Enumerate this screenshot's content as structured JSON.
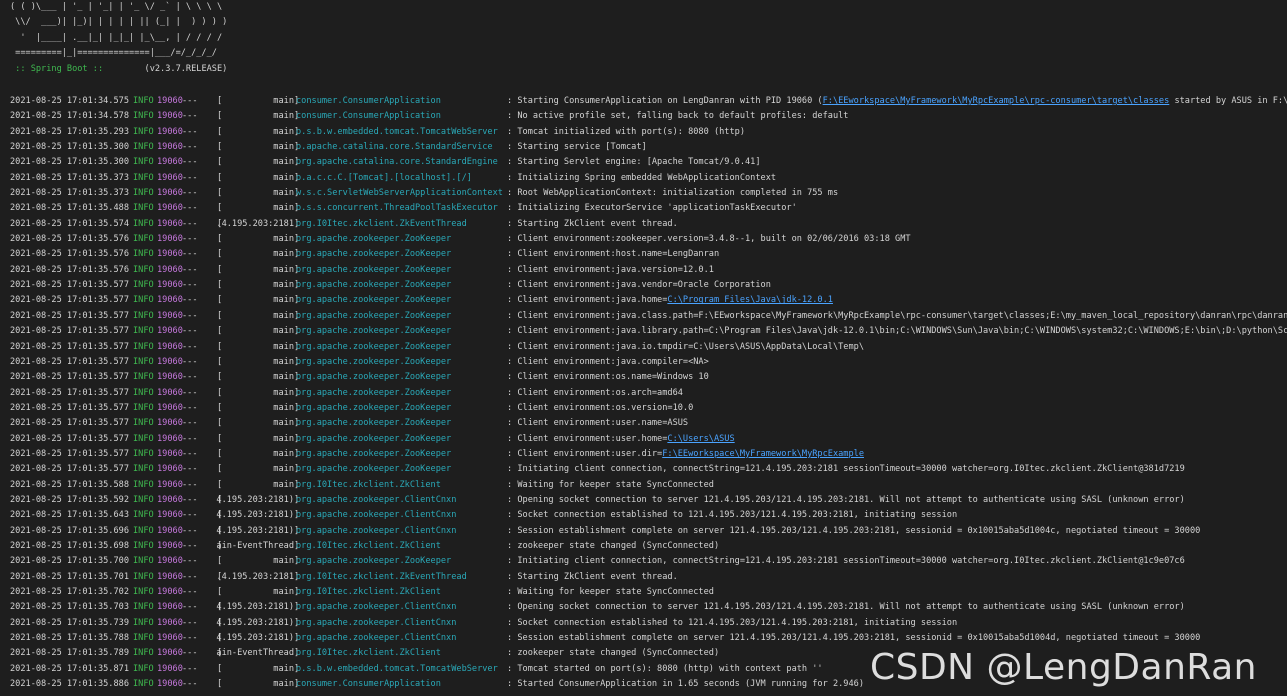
{
  "banner": {
    "lines": [
      "( ( )\\___ | '_ | '_| | '_ \\/ _` | \\ \\ \\ \\",
      " \\\\/  ___)| |_)| | | | | || (_| |  ) ) ) )",
      "  '  |____| .__|_| |_|_| |_\\__, | / / / /",
      " =========|_|==============|___/=/_/_/_/"
    ],
    "spring_label": " :: Spring Boot :: ",
    "version": "       (v2.3.7.RELEASE)"
  },
  "logs": [
    {
      "ts": "2021-08-25 17:01:34.575",
      "lvl": "INFO",
      "pid": "19060",
      "sep": "---",
      "thread": "main",
      "logger": "consumer.ConsumerApplication",
      "msg_pre": ": Starting ConsumerApplication on LengDanran with PID 19060 (",
      "link": "F:\\EEworkspace\\MyFramework\\MyRpcExample\\rpc-consumer\\target\\classes",
      "msg_post": " started by ASUS in F:\\EEworkspac"
    },
    {
      "ts": "2021-08-25 17:01:34.578",
      "lvl": "INFO",
      "pid": "19060",
      "sep": "---",
      "thread": "main",
      "logger": "consumer.ConsumerApplication",
      "msg_pre": ": No active profile set, falling back to default profiles: default",
      "link": "",
      "msg_post": ""
    },
    {
      "ts": "2021-08-25 17:01:35.293",
      "lvl": "INFO",
      "pid": "19060",
      "sep": "---",
      "thread": "main",
      "logger": "o.s.b.w.embedded.tomcat.TomcatWebServer",
      "msg_pre": ": Tomcat initialized with port(s): 8080 (http)",
      "link": "",
      "msg_post": ""
    },
    {
      "ts": "2021-08-25 17:01:35.300",
      "lvl": "INFO",
      "pid": "19060",
      "sep": "---",
      "thread": "main",
      "logger": "o.apache.catalina.core.StandardService",
      "msg_pre": ": Starting service [Tomcat]",
      "link": "",
      "msg_post": ""
    },
    {
      "ts": "2021-08-25 17:01:35.300",
      "lvl": "INFO",
      "pid": "19060",
      "sep": "---",
      "thread": "main",
      "logger": "org.apache.catalina.core.StandardEngine",
      "msg_pre": ": Starting Servlet engine: [Apache Tomcat/9.0.41]",
      "link": "",
      "msg_post": ""
    },
    {
      "ts": "2021-08-25 17:01:35.373",
      "lvl": "INFO",
      "pid": "19060",
      "sep": "---",
      "thread": "main",
      "logger": "o.a.c.c.C.[Tomcat].[localhost].[/]",
      "msg_pre": ": Initializing Spring embedded WebApplicationContext",
      "link": "",
      "msg_post": ""
    },
    {
      "ts": "2021-08-25 17:01:35.373",
      "lvl": "INFO",
      "pid": "19060",
      "sep": "---",
      "thread": "main",
      "logger": "w.s.c.ServletWebServerApplicationContext",
      "msg_pre": ": Root WebApplicationContext: initialization completed in 755 ms",
      "link": "",
      "msg_post": ""
    },
    {
      "ts": "2021-08-25 17:01:35.488",
      "lvl": "INFO",
      "pid": "19060",
      "sep": "---",
      "thread": "main",
      "logger": "o.s.s.concurrent.ThreadPoolTaskExecutor",
      "msg_pre": ": Initializing ExecutorService 'applicationTaskExecutor'",
      "link": "",
      "msg_post": ""
    },
    {
      "ts": "2021-08-25 17:01:35.574",
      "lvl": "INFO",
      "pid": "19060",
      "sep": "---",
      "thread": ".4.195.203:2181",
      "logger": "org.I0Itec.zkclient.ZkEventThread",
      "msg_pre": ": Starting ZkClient event thread.",
      "link": "",
      "msg_post": ""
    },
    {
      "ts": "2021-08-25 17:01:35.576",
      "lvl": "INFO",
      "pid": "19060",
      "sep": "---",
      "thread": "main",
      "logger": "org.apache.zookeeper.ZooKeeper",
      "msg_pre": ": Client environment:zookeeper.version=3.4.8--1, built on 02/06/2016 03:18 GMT",
      "link": "",
      "msg_post": ""
    },
    {
      "ts": "2021-08-25 17:01:35.576",
      "lvl": "INFO",
      "pid": "19060",
      "sep": "---",
      "thread": "main",
      "logger": "org.apache.zookeeper.ZooKeeper",
      "msg_pre": ": Client environment:host.name=LengDanran",
      "link": "",
      "msg_post": ""
    },
    {
      "ts": "2021-08-25 17:01:35.576",
      "lvl": "INFO",
      "pid": "19060",
      "sep": "---",
      "thread": "main",
      "logger": "org.apache.zookeeper.ZooKeeper",
      "msg_pre": ": Client environment:java.version=12.0.1",
      "link": "",
      "msg_post": ""
    },
    {
      "ts": "2021-08-25 17:01:35.577",
      "lvl": "INFO",
      "pid": "19060",
      "sep": "---",
      "thread": "main",
      "logger": "org.apache.zookeeper.ZooKeeper",
      "msg_pre": ": Client environment:java.vendor=Oracle Corporation",
      "link": "",
      "msg_post": ""
    },
    {
      "ts": "2021-08-25 17:01:35.577",
      "lvl": "INFO",
      "pid": "19060",
      "sep": "---",
      "thread": "main",
      "logger": "org.apache.zookeeper.ZooKeeper",
      "msg_pre": ": Client environment:java.home=",
      "link": "C:\\Program Files\\Java\\jdk-12.0.1",
      "msg_post": ""
    },
    {
      "ts": "2021-08-25 17:01:35.577",
      "lvl": "INFO",
      "pid": "19060",
      "sep": "---",
      "thread": "main",
      "logger": "org.apache.zookeeper.ZooKeeper",
      "msg_pre": ": Client environment:java.class.path=F:\\EEworkspace\\MyFramework\\MyRpcExample\\rpc-consumer\\target\\classes;E:\\my_maven_local_repository\\danran\\rpc\\danran-rpc-sprin",
      "link": "",
      "msg_post": ""
    },
    {
      "ts": "2021-08-25 17:01:35.577",
      "lvl": "INFO",
      "pid": "19060",
      "sep": "---",
      "thread": "main",
      "logger": "org.apache.zookeeper.ZooKeeper",
      "msg_pre": ": Client environment:java.library.path=C:\\Program Files\\Java\\jdk-12.0.1\\bin;C:\\WINDOWS\\Sun\\Java\\bin;C:\\WINDOWS\\system32;C:\\WINDOWS;E:\\bin\\;D:\\python\\Scripts\\;D:\\",
      "link": "",
      "msg_post": ""
    },
    {
      "ts": "2021-08-25 17:01:35.577",
      "lvl": "INFO",
      "pid": "19060",
      "sep": "---",
      "thread": "main",
      "logger": "org.apache.zookeeper.ZooKeeper",
      "msg_pre": ": Client environment:java.io.tmpdir=C:\\Users\\ASUS\\AppData\\Local\\Temp\\",
      "link": "",
      "msg_post": ""
    },
    {
      "ts": "2021-08-25 17:01:35.577",
      "lvl": "INFO",
      "pid": "19060",
      "sep": "---",
      "thread": "main",
      "logger": "org.apache.zookeeper.ZooKeeper",
      "msg_pre": ": Client environment:java.compiler=<NA>",
      "link": "",
      "msg_post": ""
    },
    {
      "ts": "2021-08-25 17:01:35.577",
      "lvl": "INFO",
      "pid": "19060",
      "sep": "---",
      "thread": "main",
      "logger": "org.apache.zookeeper.ZooKeeper",
      "msg_pre": ": Client environment:os.name=Windows 10",
      "link": "",
      "msg_post": ""
    },
    {
      "ts": "2021-08-25 17:01:35.577",
      "lvl": "INFO",
      "pid": "19060",
      "sep": "---",
      "thread": "main",
      "logger": "org.apache.zookeeper.ZooKeeper",
      "msg_pre": ": Client environment:os.arch=amd64",
      "link": "",
      "msg_post": ""
    },
    {
      "ts": "2021-08-25 17:01:35.577",
      "lvl": "INFO",
      "pid": "19060",
      "sep": "---",
      "thread": "main",
      "logger": "org.apache.zookeeper.ZooKeeper",
      "msg_pre": ": Client environment:os.version=10.0",
      "link": "",
      "msg_post": ""
    },
    {
      "ts": "2021-08-25 17:01:35.577",
      "lvl": "INFO",
      "pid": "19060",
      "sep": "---",
      "thread": "main",
      "logger": "org.apache.zookeeper.ZooKeeper",
      "msg_pre": ": Client environment:user.name=ASUS",
      "link": "",
      "msg_post": ""
    },
    {
      "ts": "2021-08-25 17:01:35.577",
      "lvl": "INFO",
      "pid": "19060",
      "sep": "---",
      "thread": "main",
      "logger": "org.apache.zookeeper.ZooKeeper",
      "msg_pre": ": Client environment:user.home=",
      "link": "C:\\Users\\ASUS",
      "msg_post": ""
    },
    {
      "ts": "2021-08-25 17:01:35.577",
      "lvl": "INFO",
      "pid": "19060",
      "sep": "---",
      "thread": "main",
      "logger": "org.apache.zookeeper.ZooKeeper",
      "msg_pre": ": Client environment:user.dir=",
      "link": "F:\\EEworkspace\\MyFramework\\MyRpcExample",
      "msg_post": ""
    },
    {
      "ts": "2021-08-25 17:01:35.577",
      "lvl": "INFO",
      "pid": "19060",
      "sep": "---",
      "thread": "main",
      "logger": "org.apache.zookeeper.ZooKeeper",
      "msg_pre": ": Initiating client connection, connectString=121.4.195.203:2181 sessionTimeout=30000 watcher=org.I0Itec.zkclient.ZkClient@381d7219",
      "link": "",
      "msg_post": ""
    },
    {
      "ts": "2021-08-25 17:01:35.588",
      "lvl": "INFO",
      "pid": "19060",
      "sep": "---",
      "thread": "main",
      "logger": "org.I0Itec.zkclient.ZkClient",
      "msg_pre": ": Waiting for keeper state SyncConnected",
      "link": "",
      "msg_post": ""
    },
    {
      "ts": "2021-08-25 17:01:35.592",
      "lvl": "INFO",
      "pid": "19060",
      "sep": "---",
      "thread": "4.195.203:2181)",
      "logger": "org.apache.zookeeper.ClientCnxn",
      "msg_pre": ": Opening socket connection to server 121.4.195.203/121.4.195.203:2181. Will not attempt to authenticate using SASL (unknown error)",
      "link": "",
      "msg_post": ""
    },
    {
      "ts": "2021-08-25 17:01:35.643",
      "lvl": "INFO",
      "pid": "19060",
      "sep": "---",
      "thread": "4.195.203:2181)",
      "logger": "org.apache.zookeeper.ClientCnxn",
      "msg_pre": ": Socket connection established to 121.4.195.203/121.4.195.203:2181, initiating session",
      "link": "",
      "msg_post": ""
    },
    {
      "ts": "2021-08-25 17:01:35.696",
      "lvl": "INFO",
      "pid": "19060",
      "sep": "---",
      "thread": "4.195.203:2181)",
      "logger": "org.apache.zookeeper.ClientCnxn",
      "msg_pre": ": Session establishment complete on server 121.4.195.203/121.4.195.203:2181, sessionid = 0x10015aba5d1004c, negotiated timeout = 30000",
      "link": "",
      "msg_post": ""
    },
    {
      "ts": "2021-08-25 17:01:35.698",
      "lvl": "INFO",
      "pid": "19060",
      "sep": "---",
      "thread": "ain-EventThread",
      "logger": "org.I0Itec.zkclient.ZkClient",
      "msg_pre": ": zookeeper state changed (SyncConnected)",
      "link": "",
      "msg_post": ""
    },
    {
      "ts": "2021-08-25 17:01:35.700",
      "lvl": "INFO",
      "pid": "19060",
      "sep": "---",
      "thread": "main",
      "logger": "org.apache.zookeeper.ZooKeeper",
      "msg_pre": ": Initiating client connection, connectString=121.4.195.203:2181 sessionTimeout=30000 watcher=org.I0Itec.zkclient.ZkClient@1c9e07c6",
      "link": "",
      "msg_post": ""
    },
    {
      "ts": "2021-08-25 17:01:35.701",
      "lvl": "INFO",
      "pid": "19060",
      "sep": "---",
      "thread": ".4.195.203:2181",
      "logger": "org.I0Itec.zkclient.ZkEventThread",
      "msg_pre": ": Starting ZkClient event thread.",
      "link": "",
      "msg_post": ""
    },
    {
      "ts": "2021-08-25 17:01:35.702",
      "lvl": "INFO",
      "pid": "19060",
      "sep": "---",
      "thread": "main",
      "logger": "org.I0Itec.zkclient.ZkClient",
      "msg_pre": ": Waiting for keeper state SyncConnected",
      "link": "",
      "msg_post": ""
    },
    {
      "ts": "2021-08-25 17:01:35.703",
      "lvl": "INFO",
      "pid": "19060",
      "sep": "---",
      "thread": "4.195.203:2181)",
      "logger": "org.apache.zookeeper.ClientCnxn",
      "msg_pre": ": Opening socket connection to server 121.4.195.203/121.4.195.203:2181. Will not attempt to authenticate using SASL (unknown error)",
      "link": "",
      "msg_post": ""
    },
    {
      "ts": "2021-08-25 17:01:35.739",
      "lvl": "INFO",
      "pid": "19060",
      "sep": "---",
      "thread": "4.195.203:2181)",
      "logger": "org.apache.zookeeper.ClientCnxn",
      "msg_pre": ": Socket connection established to 121.4.195.203/121.4.195.203:2181, initiating session",
      "link": "",
      "msg_post": ""
    },
    {
      "ts": "2021-08-25 17:01:35.788",
      "lvl": "INFO",
      "pid": "19060",
      "sep": "---",
      "thread": "4.195.203:2181)",
      "logger": "org.apache.zookeeper.ClientCnxn",
      "msg_pre": ": Session establishment complete on server 121.4.195.203/121.4.195.203:2181, sessionid = 0x10015aba5d1004d, negotiated timeout = 30000",
      "link": "",
      "msg_post": ""
    },
    {
      "ts": "2021-08-25 17:01:35.789",
      "lvl": "INFO",
      "pid": "19060",
      "sep": "---",
      "thread": "ain-EventThread",
      "logger": "org.I0Itec.zkclient.ZkClient",
      "msg_pre": ": zookeeper state changed (SyncConnected)",
      "link": "",
      "msg_post": ""
    },
    {
      "ts": "2021-08-25 17:01:35.871",
      "lvl": "INFO",
      "pid": "19060",
      "sep": "---",
      "thread": "main",
      "logger": "o.s.b.w.embedded.tomcat.TomcatWebServer",
      "msg_pre": ": Tomcat started on port(s): 8080 (http) with context path ''",
      "link": "",
      "msg_post": ""
    },
    {
      "ts": "2021-08-25 17:01:35.886",
      "lvl": "INFO",
      "pid": "19060",
      "sep": "---",
      "thread": "main",
      "logger": "consumer.ConsumerApplication",
      "msg_pre": ": Started ConsumerApplication in 1.65 seconds (JVM running for 2.946)",
      "link": "",
      "msg_post": ""
    }
  ],
  "watermark": "CSDN @LengDanRan",
  "colors": {
    "background": "#1e1e1e",
    "text": "#d4d4d4",
    "level": "#3fb950",
    "pid": "#c678dd",
    "logger": "#2aa9b8",
    "link": "#4aa3ff"
  }
}
